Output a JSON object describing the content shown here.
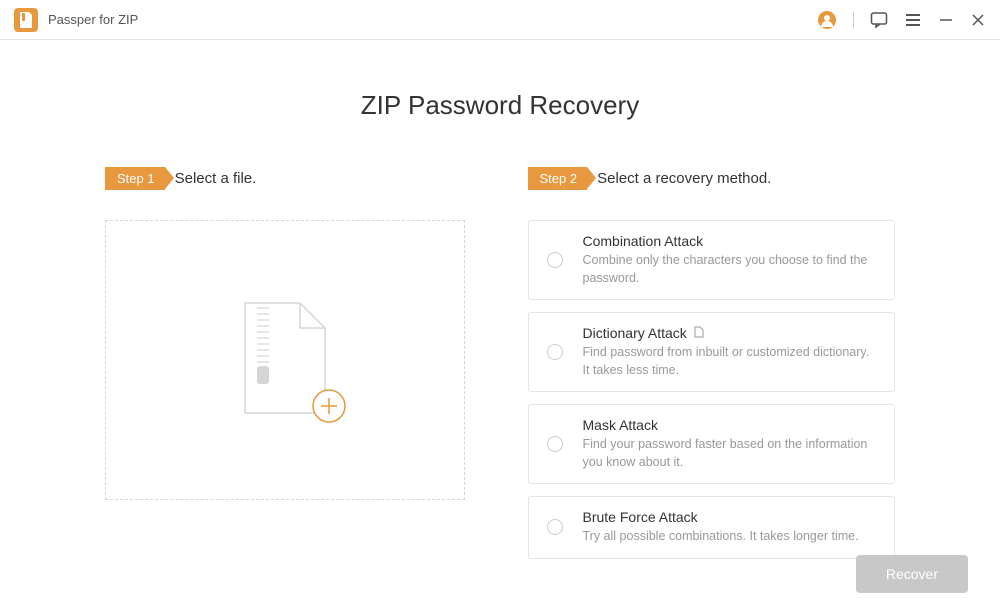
{
  "app": {
    "title": "Passper for ZIP"
  },
  "page": {
    "title": "ZIP Password Recovery"
  },
  "step1": {
    "badge": "Step 1",
    "label": "Select a file."
  },
  "step2": {
    "badge": "Step 2",
    "label": "Select a recovery method."
  },
  "methods": [
    {
      "title": "Combination Attack",
      "desc": "Combine only the characters you choose to find the password."
    },
    {
      "title": "Dictionary Attack",
      "desc": "Find password from inbuilt or customized dictionary. It takes less time."
    },
    {
      "title": "Mask Attack",
      "desc": "Find your password faster based on the information you know about it."
    },
    {
      "title": "Brute Force Attack",
      "desc": "Try all possible combinations. It takes longer time."
    }
  ],
  "recover_label": "Recover"
}
